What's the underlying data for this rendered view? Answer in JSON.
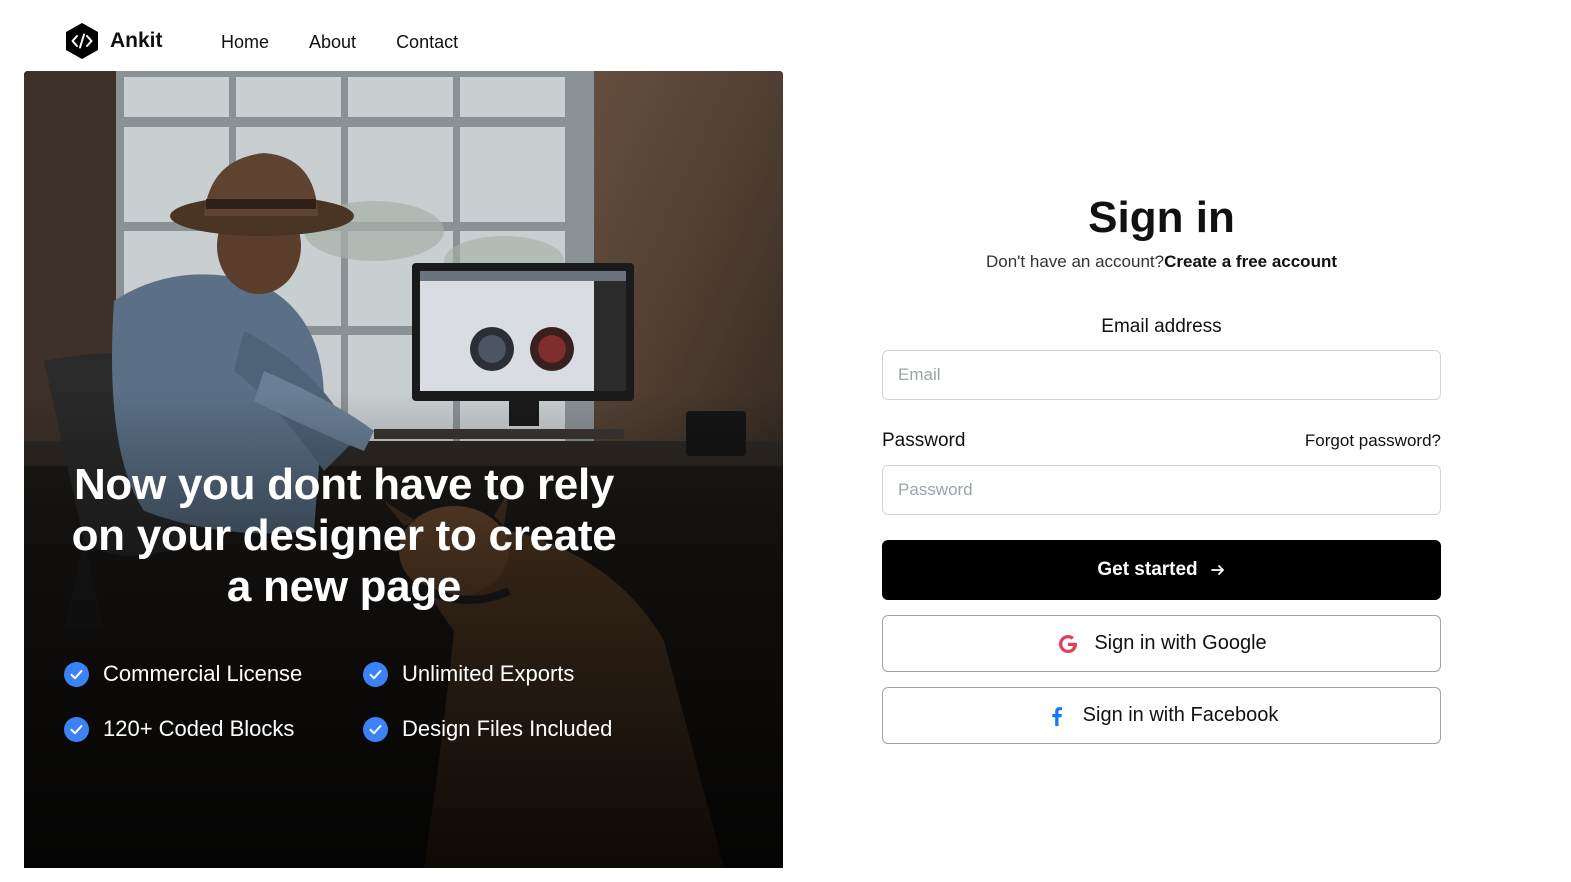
{
  "nav": {
    "brand": "Ankit",
    "links": [
      "Home",
      "About",
      "Contact"
    ]
  },
  "hero": {
    "headline": "Now you dont have to rely on your designer to create a new page",
    "features": [
      "Commercial License",
      "Unlimited Exports",
      "120+ Coded Blocks",
      "Design Files Included"
    ]
  },
  "signin": {
    "title": "Sign in",
    "subtitle": "Don't have an account?",
    "create_link": "Create a free account",
    "email_label": "Email address",
    "email_placeholder": "Email",
    "password_label": "Password",
    "forgot_link": "Forgot password?",
    "password_placeholder": "Password",
    "submit_label": "Get started",
    "google_label": "Sign in with Google",
    "facebook_label": "Sign in with Facebook"
  },
  "colors": {
    "primary_button": "#000000",
    "check_badge": "#3b82f6",
    "google_red": "#ea4335",
    "facebook_blue": "#1877f2",
    "input_border": "#d4d4d8"
  },
  "icons": {
    "brand": "code-hexagon-icon",
    "feature": "check-circle-icon",
    "submit": "arrow-right-icon",
    "google": "google-icon",
    "facebook": "facebook-icon"
  }
}
